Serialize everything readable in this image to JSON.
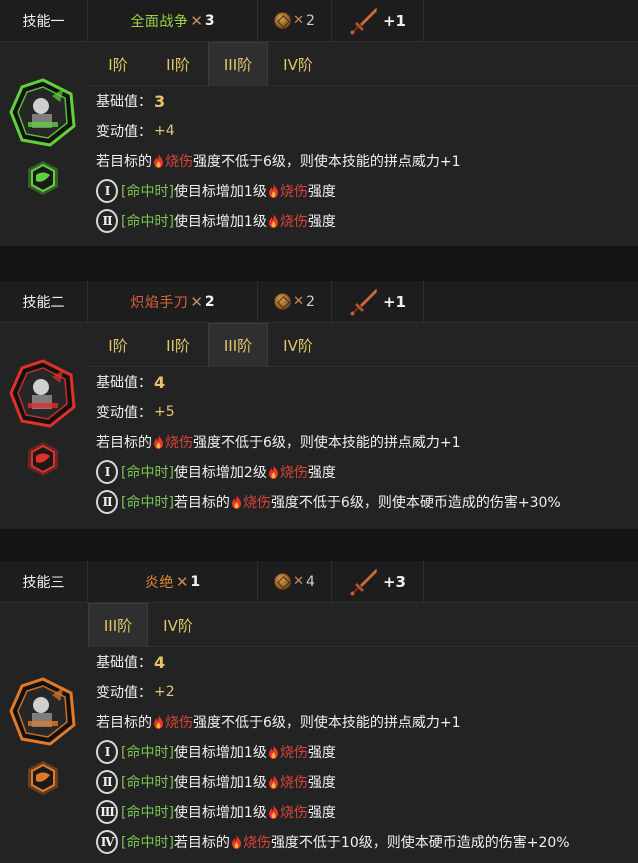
{
  "skills": [
    {
      "label": "技能一",
      "name": "全面战争",
      "name_color": "#9bd24a",
      "mult": "3",
      "coins": "2",
      "power": "+1",
      "theme": "#5fd13a",
      "tabs": [
        "I阶",
        "II阶",
        "III阶",
        "IV阶"
      ],
      "active_tab": 2,
      "base_label": "基础值：",
      "base": "3",
      "var_label": "变动值：",
      "var": "+4",
      "lines": [
        {
          "pre": "若目标的",
          "burn": "烧伤",
          "post": "强度不低于6级，则使本技能的拼点威力+1"
        },
        {
          "roman": "Ⅰ",
          "tag": "[命中时]",
          "pre": "使目标增加1级",
          "burn": "烧伤",
          "post": "强度"
        },
        {
          "roman": "Ⅱ",
          "tag": "[命中时]",
          "pre": "使目标增加1级",
          "burn": "烧伤",
          "post": "强度"
        }
      ]
    },
    {
      "label": "技能二",
      "name": "炽焰手刀",
      "name_color": "#e0603a",
      "mult": "2",
      "coins": "2",
      "power": "+1",
      "theme": "#e0302a",
      "tabs": [
        "I阶",
        "II阶",
        "III阶",
        "IV阶"
      ],
      "active_tab": 2,
      "base_label": "基础值：",
      "base": "4",
      "var_label": "变动值：",
      "var": "+5",
      "lines": [
        {
          "pre": "若目标的",
          "burn": "烧伤",
          "post": "强度不低于6级，则使本技能的拼点威力+1"
        },
        {
          "roman": "Ⅰ",
          "tag": "[命中时]",
          "pre": "使目标增加2级",
          "burn": "烧伤",
          "post": "强度"
        },
        {
          "roman": "Ⅱ",
          "tag": "[命中时]",
          "pre": "若目标的",
          "burn": "烧伤",
          "post": "强度不低于6级，则使本硬币造成的伤害+30%"
        }
      ]
    },
    {
      "label": "技能三",
      "name": "炎绝",
      "name_color": "#e48a3a",
      "mult": "1",
      "coins": "4",
      "power": "+3",
      "theme": "#e07a2a",
      "tabs": [
        "III阶",
        "IV阶"
      ],
      "active_tab": 0,
      "base_label": "基础值：",
      "base": "4",
      "var_label": "变动值：",
      "var": "+2",
      "lines": [
        {
          "pre": "若目标的",
          "burn": "烧伤",
          "post": "强度不低于6级，则使本技能的拼点威力+1"
        },
        {
          "roman": "Ⅰ",
          "tag": "[命中时]",
          "pre": "使目标增加1级",
          "burn": "烧伤",
          "post": "强度"
        },
        {
          "roman": "Ⅱ",
          "tag": "[命中时]",
          "pre": "使目标增加1级",
          "burn": "烧伤",
          "post": "强度"
        },
        {
          "roman": "Ⅲ",
          "tag": "[命中时]",
          "pre": "使目标增加1级",
          "burn": "烧伤",
          "post": "强度"
        },
        {
          "roman": "Ⅳ",
          "tag": "[命中时]",
          "pre": "若目标的",
          "burn": "烧伤",
          "post": "强度不低于10级，则使本硬币造成的伤害+20%"
        }
      ]
    }
  ]
}
